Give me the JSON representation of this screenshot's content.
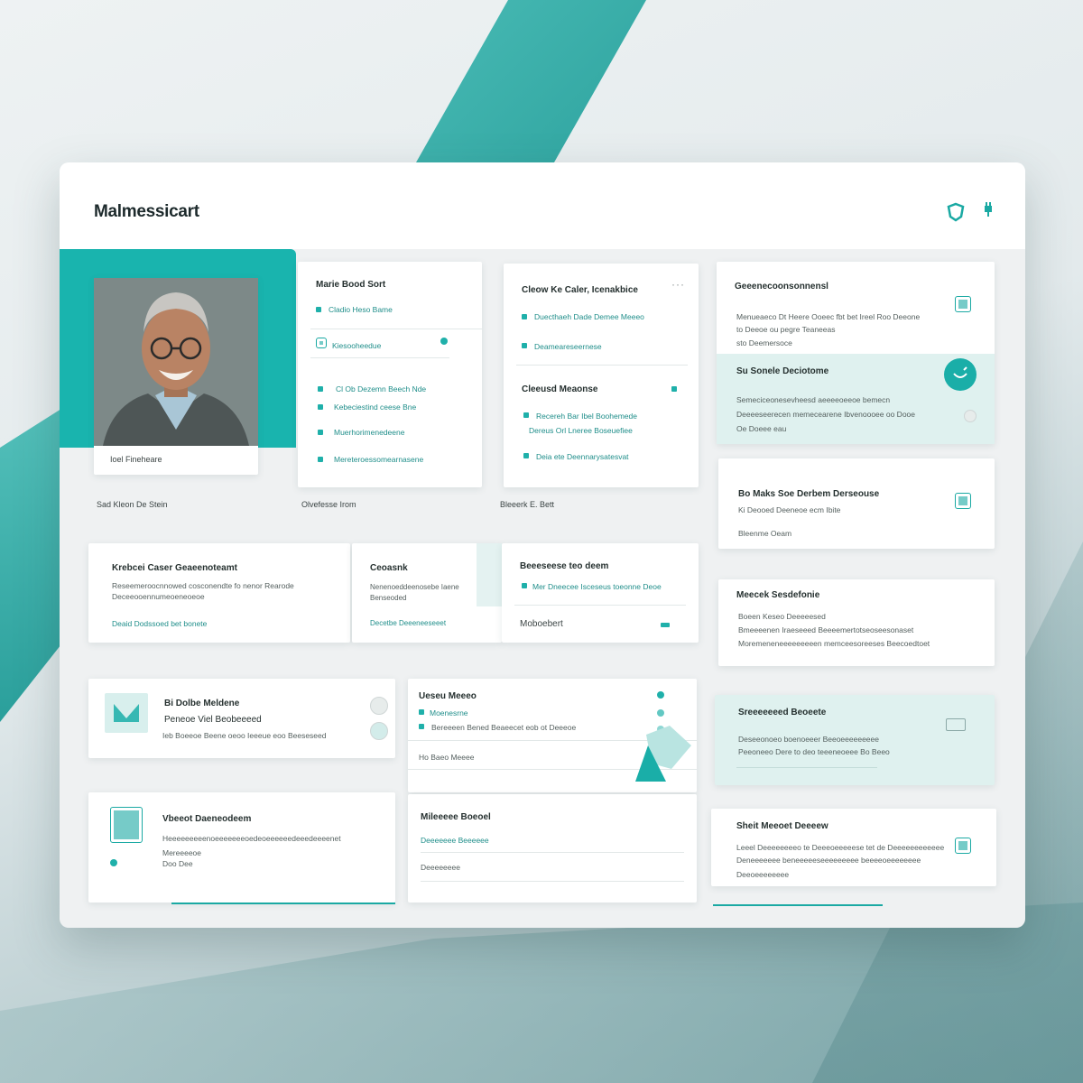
{
  "app": {
    "title": "Malmessicart"
  },
  "profile": {
    "name_caption": "Ioel Fineheare",
    "below_caption": "Sad Kleon De Stein"
  },
  "card_a": {
    "title": "Marie Bood Sort",
    "items": [
      "Cladio Heso Bame",
      "Kiesooheedue",
      "Cl Ob Dezemn Beech Nde",
      "Kebeciestind ceese Bne",
      "Muerhorimenedeene",
      "Mereteroessomearnasene"
    ],
    "caption": "Olvefesse Irom"
  },
  "card_b": {
    "title": "Cleow Ke Caler, Icenakbice",
    "menu": "···",
    "items": [
      "Duecthaeh Dade Demee Meeeo",
      "Deameareseernese"
    ],
    "section_title": "Cleeusd Meaonse",
    "section_items": [
      "Recereh Bar Ibel Boohemede",
      "Dereus Orl Lneree Boseuefiee",
      "Deia ete Deennarysatesvat"
    ],
    "caption": "Bleeerk E. Bett"
  },
  "card_c": {
    "title": "Geeenecoonsonnensl",
    "lines": [
      "Menueaeco Dt Heere Ooeec fbt bet Ireel Roo Deeone",
      "to Deeoe ou pegre Teaneeas",
      "sto Deemersoce"
    ]
  },
  "card_c_mint": {
    "title": "Su Sonele Deciotome",
    "lines": [
      "Semeciceonesevheesd aeeeeoeeoe bemecn",
      "Deeeeseerecen memecearene Ibvenoooee oo Dooe",
      "Oe Doeee eau"
    ]
  },
  "card_d": {
    "title": "Bo Maks Soe Derbem Derseouse",
    "lines": [
      "Ki Deooed Deeneoe ecm Ibite",
      "Bleenme Oeam"
    ]
  },
  "card_e": {
    "title": "Meecek Sesdefonie",
    "lines": [
      "Boeen Keseo Deeeeesed",
      "Bmeeeenen Iraeseeed Beeeemertotseoseesonaset",
      "Moremeneneeeeeeeeen memceesoreeses Beecoedtoet"
    ]
  },
  "card_f": {
    "title": "Krebcei Caser Geaeenoteamt",
    "lines": [
      "Reseemeroocnnowed cosconendte fo nenor Rearode",
      "Deceeooennumeoeneoeoe"
    ],
    "link": "Deaid Dodssoed bet bonete"
  },
  "card_g": {
    "title": "Ceoasnk",
    "lines": [
      "Nenenoeddeenosebe Iaene",
      "Benseoded"
    ],
    "link": "Decetbe Deeeneeseeet"
  },
  "card_h": {
    "title": "Beeeseese teo deem",
    "line": "Mer Dneecee Isceseus toeonne Deoe",
    "footer": "Moboebert"
  },
  "card_i": {
    "title": "Sreeeeeeed Beoeete",
    "lines": [
      "Deseeonoeo boenoeeer Beeoeeeeeeeee",
      "Peeoneeo Dere to deo teeeneoeee Bo Beeo"
    ]
  },
  "card_j": {
    "title": "Bi Dolbe Meldene",
    "subtitle": "Peneoe Viel Beobeeeed",
    "line": "Ieb Boeeoe Beene oeoo Ieeeue eoo Beeseseed"
  },
  "card_k": {
    "title": "Vbeeot Daeneodeem",
    "lines": [
      "Heeeeeeeeenoeeeeeeeoedeoeeeeeedeeedeeeenet",
      "Mereeeeoe",
      "Doo Dee"
    ]
  },
  "card_l": {
    "title": "Ueseu Meeeo",
    "items": [
      "Moenesrne",
      "Bereeeen Bened Beaeecet eob ot Deeeoe"
    ],
    "line2": "Ho Baeo Meeee"
  },
  "card_m": {
    "title": "Mileeeee Boeoel",
    "link": "Deeeeeee Beeeeee",
    "line": "Deeeeeeee"
  },
  "card_n": {
    "title": "Sheit Meeoet Deeeew",
    "lines": [
      "Leeel Deeeeeeeeo te Deeeoeeeeese tet de Deeeeeeeeeeee",
      "Deneeeeeee beneeeeeseeeeeeeee beeeeoeeeeeeee",
      "Deeoeeeeeeee"
    ]
  },
  "colors": {
    "accent": "#1aaea8",
    "mint": "#dff1ef"
  }
}
